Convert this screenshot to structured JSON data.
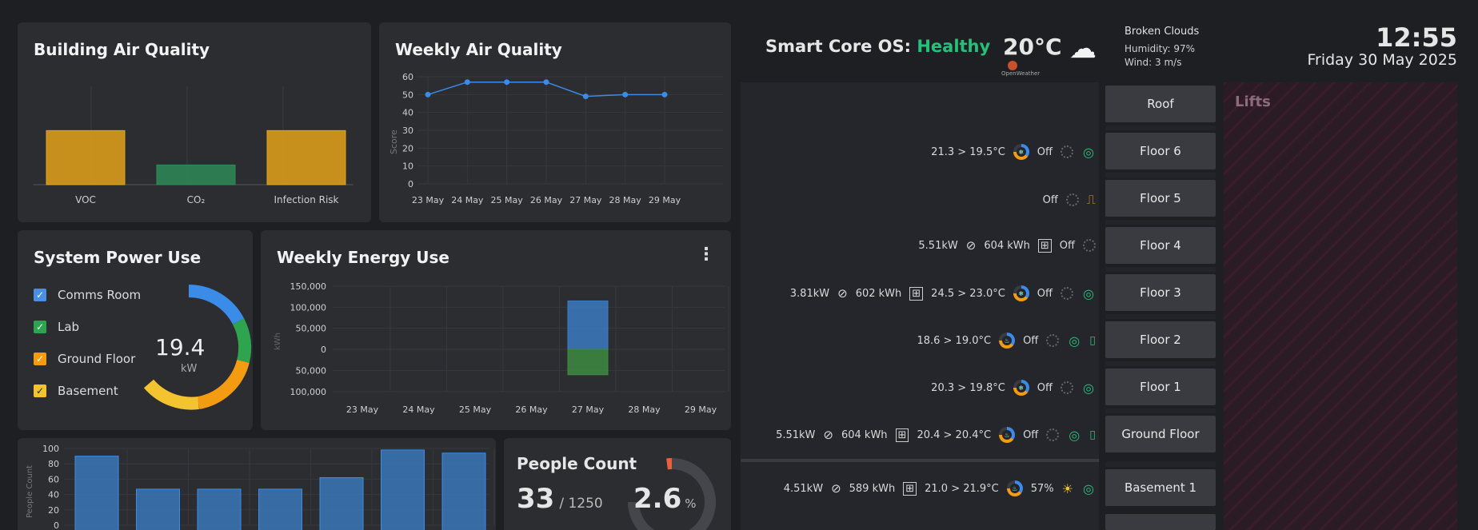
{
  "air_quality": {
    "title": "Building Air Quality",
    "bars": [
      {
        "label": "VOC",
        "value": 0.55,
        "color": "#e3a21a"
      },
      {
        "label": "CO₂",
        "value": 0.2,
        "color": "#2e8b57"
      },
      {
        "label": "Infection Risk",
        "value": 0.55,
        "color": "#e3a21a"
      }
    ]
  },
  "weekly_air": {
    "title": "Weekly Air Quality",
    "ylabel": "Score",
    "chart_data": {
      "type": "line",
      "x": [
        "23 May",
        "24 May",
        "25 May",
        "26 May",
        "27 May",
        "28 May",
        "29 May"
      ],
      "values": [
        50,
        57,
        57,
        57,
        49,
        50,
        50
      ],
      "ylim": [
        0,
        60
      ],
      "yticks": [
        "60",
        "50",
        "40",
        "30",
        "20",
        "10",
        "0"
      ]
    }
  },
  "power": {
    "title": "System Power Use",
    "value": "19.4",
    "unit": "kW",
    "items": [
      {
        "label": "Comms Room",
        "color": "#4a90e2"
      },
      {
        "label": "Lab",
        "color": "#2ea44f"
      },
      {
        "label": "Ground Floor",
        "color": "#f39c12"
      },
      {
        "label": "Basement",
        "color": "#f4c430"
      }
    ]
  },
  "weekly_energy": {
    "title": "Weekly Energy Use",
    "menu_icon": "more-vertical-icon",
    "ylabel": "kWh",
    "chart_data": {
      "type": "bar",
      "x": [
        "23 May",
        "24 May",
        "25 May",
        "26 May",
        "27 May",
        "28 May",
        "29 May"
      ],
      "series": [
        {
          "values": [
            0,
            0,
            0,
            0,
            115000,
            0,
            0
          ]
        },
        {
          "values": [
            0,
            0,
            0,
            0,
            -60000,
            0,
            0
          ]
        }
      ],
      "yticks": [
        "150,000",
        "100,000",
        "50,000",
        "0",
        "50,000",
        "100,000"
      ],
      "ylim": [
        -100000,
        150000
      ]
    }
  },
  "people_chart": {
    "ylabel": "People Count",
    "chart_data": {
      "type": "bar",
      "values": [
        90,
        47,
        47,
        47,
        62,
        98,
        94
      ],
      "ylim": [
        0,
        100
      ],
      "yticks": [
        "100",
        "80",
        "60",
        "40",
        "20",
        "0"
      ]
    }
  },
  "people_count": {
    "title": "People Count",
    "count": "33",
    "capacity": "/ 1250",
    "percent": "2.6",
    "percent_unit": "%"
  },
  "header": {
    "title": "Smart Core OS:",
    "status": "Healthy",
    "status_color": "#27c07a",
    "temp": "20°C",
    "weather_icon": "cloud-icon",
    "provider": "OpenWeather",
    "weather_desc": "Broken Clouds",
    "humidity": "Humidity: 97%",
    "wind": "Wind: 3 m/s",
    "time": "12:55",
    "date": "Friday 30 May 2025"
  },
  "floors": {
    "lifts_label": "Lifts",
    "items": [
      {
        "name": "Roof",
        "info": ""
      },
      {
        "name": "Floor 6",
        "temp": "21.3 > 19.5°C",
        "state": "Off"
      },
      {
        "name": "Floor 5",
        "state": "Off"
      },
      {
        "name": "Floor 4",
        "power": "5.51kW",
        "energy": "604 kWh",
        "state": "Off"
      },
      {
        "name": "Floor 3",
        "power": "3.81kW",
        "energy": "602 kWh",
        "temp": "24.5 > 23.0°C",
        "state": "Off"
      },
      {
        "name": "Floor 2",
        "temp": "18.6 > 19.0°C",
        "state": "Off"
      },
      {
        "name": "Floor 1",
        "temp": "20.3 > 19.8°C",
        "state": "Off"
      },
      {
        "name": "Ground Floor",
        "power": "5.51kW",
        "energy": "604 kWh",
        "temp": "20.4 > 20.4°C",
        "state": "Off"
      },
      {
        "name": "Basement 1",
        "power": "4.51kW",
        "energy": "589 kWh",
        "temp": "21.0 > 21.9°C",
        "state": "57%"
      }
    ]
  }
}
